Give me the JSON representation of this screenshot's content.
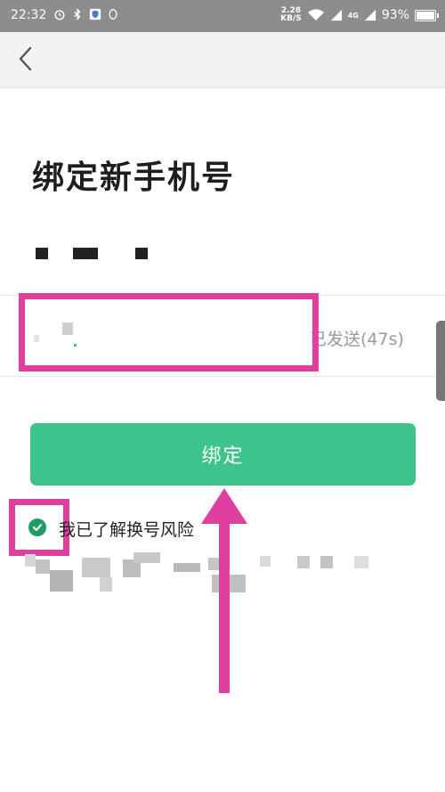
{
  "status_bar": {
    "time": "22:32",
    "speed": "2.28",
    "speed_unit": "KB/S",
    "network_4g": "4G",
    "battery": "93%",
    "battery_level": 0.93
  },
  "nav": {
    "back_icon": "chevron-left-icon"
  },
  "page": {
    "title": "绑定新手机号",
    "code_input": {
      "value": "",
      "placeholder": ""
    },
    "resend_text": "已发送(47s)",
    "bind_button": "绑定",
    "agree_text": "我已了解换号风险"
  },
  "colors": {
    "accent_green": "#3cc48b",
    "check_green": "#1f9d64",
    "highlight_pink": "#e13fa0",
    "status_bar": "#8d8d8d"
  }
}
